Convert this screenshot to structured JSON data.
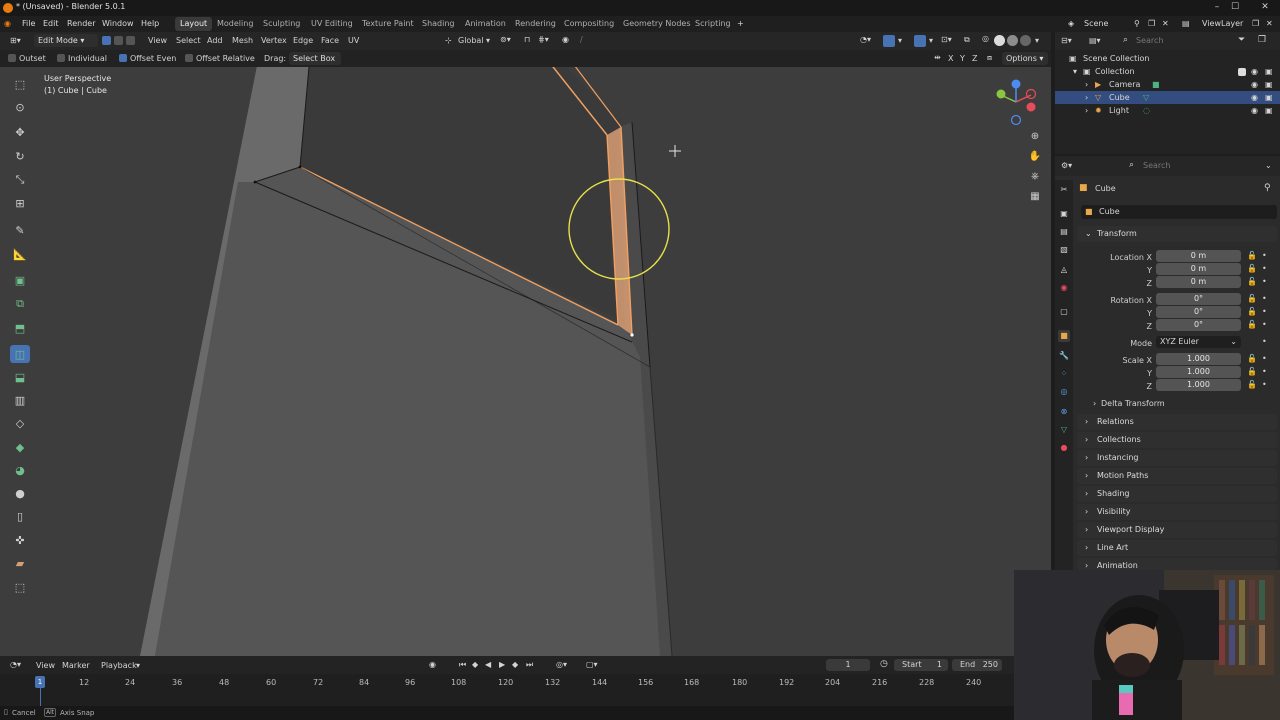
{
  "window": {
    "title": "* (Unsaved) - Blender 5.0.1"
  },
  "menu": [
    "File",
    "Edit",
    "Render",
    "Window",
    "Help"
  ],
  "workspaces": [
    "Layout",
    "Modeling",
    "Sculpting",
    "UV Editing",
    "Texture Paint",
    "Shading",
    "Animation",
    "Rendering",
    "Compositing",
    "Geometry Nodes",
    "Scripting"
  ],
  "active_workspace": "Layout",
  "scene": {
    "name": "Scene",
    "view_layer": "ViewLayer"
  },
  "viewport_header": {
    "mode": "Edit Mode",
    "menus": [
      "View",
      "Select",
      "Add",
      "Mesh",
      "Vertex",
      "Edge",
      "Face",
      "UV"
    ],
    "transform_orientation": "Global",
    "options_label": "Options",
    "axes": [
      "X",
      "Y",
      "Z"
    ]
  },
  "tool_options": {
    "outset": "Outset",
    "individual": "Individual",
    "offset_even": "Offset Even",
    "offset_relative": "Offset Relative",
    "drag_label": "Drag:",
    "drag_value": "Select Box"
  },
  "viewport": {
    "view_name": "User Perspective",
    "object_info": "(1) Cube | Cube"
  },
  "outliner": {
    "search_placeholder": "Search",
    "root": "Scene Collection",
    "collection": "Collection",
    "items": [
      {
        "name": "Camera",
        "selected": false
      },
      {
        "name": "Cube",
        "selected": true
      },
      {
        "name": "Light",
        "selected": false
      }
    ]
  },
  "properties": {
    "search_placeholder": "Search",
    "object_name": "Cube",
    "datablock_name": "Cube",
    "transform_title": "Transform",
    "location_label": "Location X",
    "location": [
      "0 m",
      "0 m",
      "0 m"
    ],
    "rotation_label": "Rotation X",
    "rotation": [
      "0°",
      "0°",
      "0°"
    ],
    "mode_label": "Mode",
    "mode_value": "XYZ Euler",
    "scale_label": "Scale X",
    "scale": [
      "1.000",
      "1.000",
      "1.000"
    ],
    "axis_y": "Y",
    "axis_z": "Z",
    "delta_transform": "Delta Transform",
    "panels": [
      "Relations",
      "Collections",
      "Instancing",
      "Motion Paths",
      "Shading",
      "Visibility",
      "Viewport Display",
      "Line Art",
      "Animation"
    ]
  },
  "timeline": {
    "menus": [
      "View",
      "Marker",
      "Playback"
    ],
    "current_frame": "1",
    "start_label": "Start",
    "start": "1",
    "end_label": "End",
    "end": "250",
    "ticks": [
      "12",
      "24",
      "36",
      "48",
      "60",
      "72",
      "84",
      "96",
      "108",
      "120",
      "132",
      "144",
      "156",
      "168",
      "180",
      "192",
      "204",
      "216",
      "228",
      "240"
    ],
    "playhead": "1"
  },
  "status_bar": {
    "cancel": "Cancel",
    "axis_snap": "Axis Snap",
    "alt_key": "Alt"
  },
  "colors": {
    "selection_orange": "#f0a060",
    "accent_blue": "#4772b3",
    "brush_circle": "#e6e04a"
  }
}
